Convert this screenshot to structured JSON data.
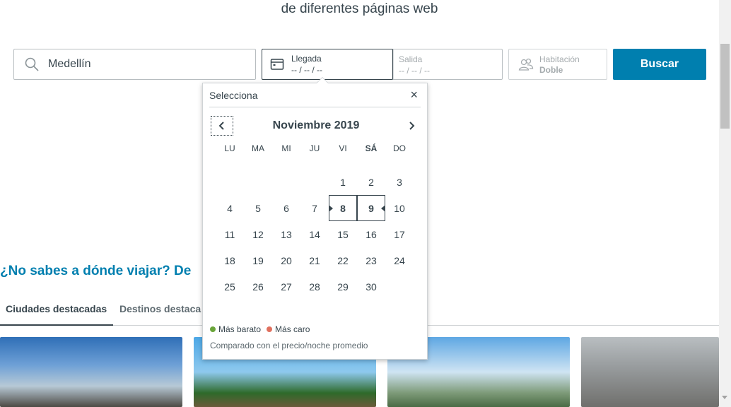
{
  "headline": "de diferentes páginas web",
  "search": {
    "destination_value": "Medellín"
  },
  "dates": {
    "checkin_label": "Llegada",
    "checkin_value": "-- / -- / --",
    "checkout_label": "Salida",
    "checkout_value": "-- / -- / --"
  },
  "room": {
    "label": "Habitación",
    "value": "Doble"
  },
  "search_button": "Buscar",
  "promo": {
    "title": "¿No sabes a dónde viajar? De"
  },
  "tabs": [
    {
      "label": "Ciudades destacadas"
    },
    {
      "label": "Destinos destaca"
    }
  ],
  "calendar": {
    "title": "Selecciona",
    "close": "×",
    "month": "Noviembre 2019",
    "prev_icon": "chevron-left",
    "next_icon": "chevron-right",
    "weekdays": [
      "LU",
      "MA",
      "MI",
      "JU",
      "VI",
      "SÁ",
      "DO"
    ],
    "weeks": [
      [
        "",
        "",
        "",
        "",
        "1",
        "2",
        "3"
      ],
      [
        "4",
        "5",
        "6",
        "7",
        "8",
        "9",
        "10"
      ],
      [
        "11",
        "12",
        "13",
        "14",
        "15",
        "16",
        "17"
      ],
      [
        "18",
        "19",
        "20",
        "21",
        "22",
        "23",
        "24"
      ],
      [
        "25",
        "26",
        "27",
        "28",
        "29",
        "30",
        ""
      ]
    ],
    "selected_start": "8",
    "selected_end": "9",
    "legend": [
      {
        "label": "Más barato",
        "color": "#6aa53a"
      },
      {
        "label": "Más caro",
        "color": "#e0705e"
      }
    ],
    "note": "Comparado con el precio/noche promedio"
  }
}
